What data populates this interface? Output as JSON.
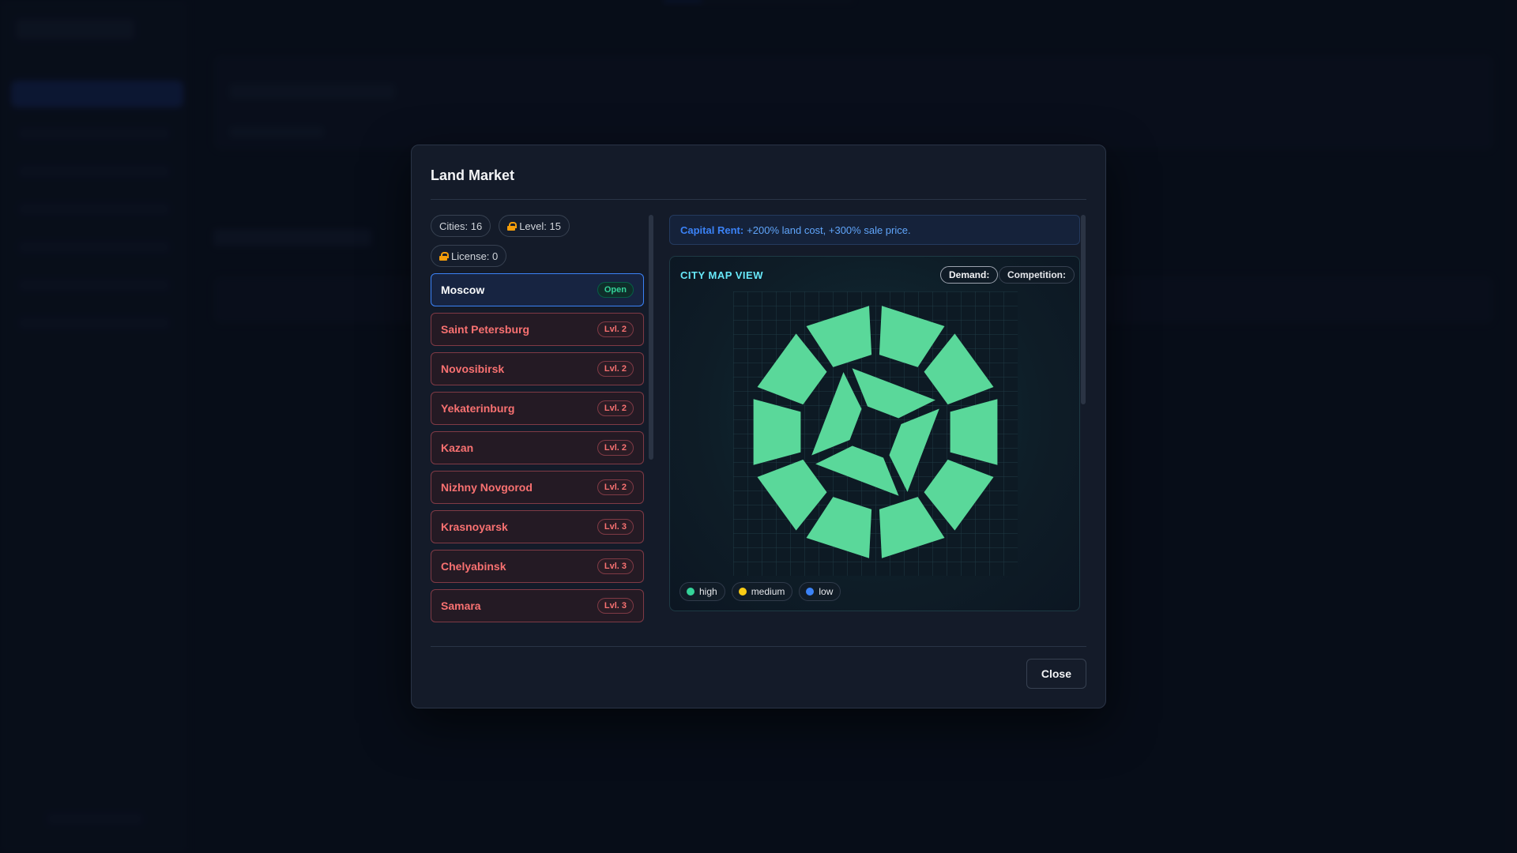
{
  "modal": {
    "title": "Land Market",
    "close_label": "Close"
  },
  "stats": {
    "cities": "Cities: 16",
    "level": "Level: 15",
    "license": "License: 0"
  },
  "cities": [
    {
      "name": "Moscow",
      "status": "Open",
      "active": true
    },
    {
      "name": "Saint Petersburg",
      "status": "Lvl. 2"
    },
    {
      "name": "Novosibirsk",
      "status": "Lvl. 2"
    },
    {
      "name": "Yekaterinburg",
      "status": "Lvl. 2"
    },
    {
      "name": "Kazan",
      "status": "Lvl. 2"
    },
    {
      "name": "Nizhny Novgorod",
      "status": "Lvl. 2"
    },
    {
      "name": "Krasnoyarsk",
      "status": "Lvl. 3"
    },
    {
      "name": "Chelyabinsk",
      "status": "Lvl. 3"
    },
    {
      "name": "Samara",
      "status": "Lvl. 3"
    }
  ],
  "capital_note": {
    "label": "Capital Rent:",
    "text": "+200% land cost, +300% sale price."
  },
  "map": {
    "title": "CITY MAP VIEW",
    "demand_label": "Demand:",
    "competition_label": "Competition:",
    "legend": [
      {
        "label": "high",
        "color": "#34d399"
      },
      {
        "label": "medium",
        "color": "#facc15"
      },
      {
        "label": "low",
        "color": "#3b82f6"
      }
    ],
    "plot_color": "#5ad89a"
  }
}
